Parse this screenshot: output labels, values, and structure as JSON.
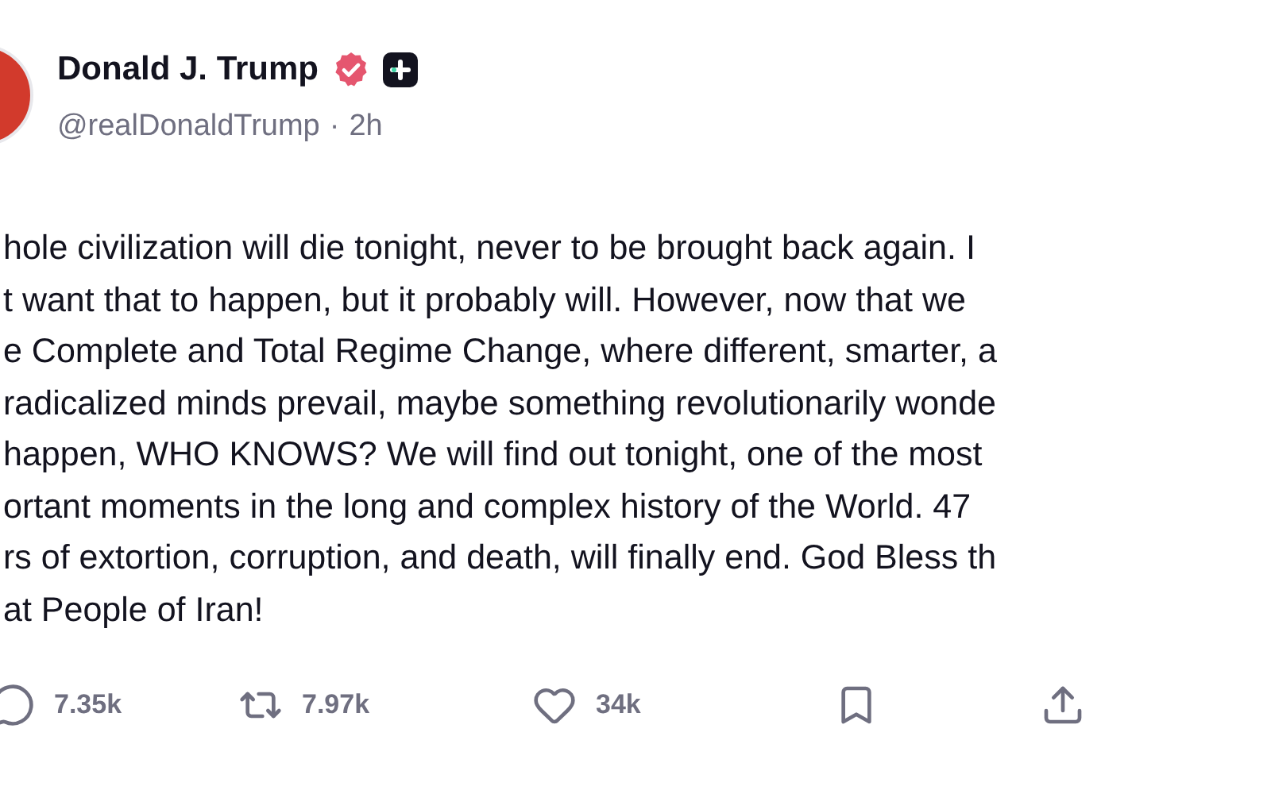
{
  "author": {
    "name": "Donald J. Trump",
    "verified": true,
    "handle": "@realDonaldTrump",
    "separator": "·",
    "time": "2h"
  },
  "post_lines": [
    "hole civilization will die tonight, never to be brought back again. I",
    "t want that to happen, but it probably will. However, now that we",
    "e Complete and Total Regime Change, where different, smarter, a",
    "radicalized minds prevail, maybe something revolutionarily wonde",
    "happen, WHO KNOWS? We will find out tonight, one of the most",
    "ortant moments in the long and complex history of the World. 47",
    "rs of extortion, corruption, and death, will finally end. God Bless th",
    "at People of Iran!"
  ],
  "actions": [
    {
      "kind": "reply",
      "count": "7.35k"
    },
    {
      "kind": "repost",
      "count": "7.97k"
    },
    {
      "kind": "like",
      "count": "34k"
    },
    {
      "kind": "bookmark"
    },
    {
      "kind": "share"
    }
  ]
}
